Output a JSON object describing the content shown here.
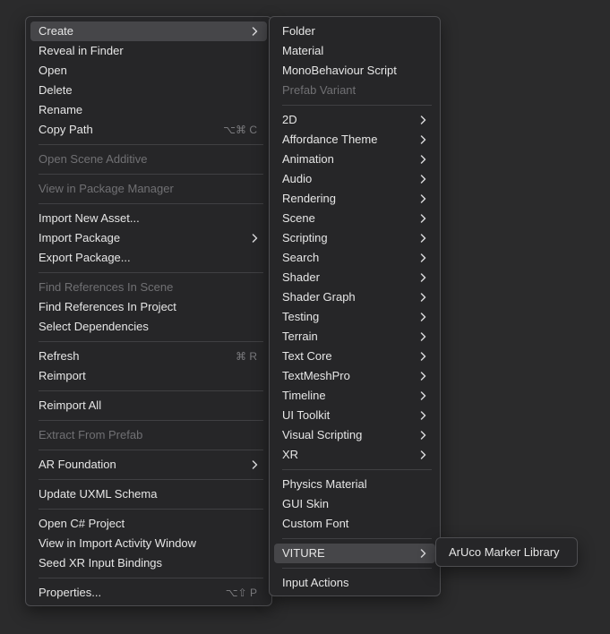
{
  "main_menu": {
    "groups": [
      [
        {
          "label": "Create",
          "submenu": true,
          "highlighted": true
        },
        {
          "label": "Reveal in Finder"
        },
        {
          "label": "Open"
        },
        {
          "label": "Delete"
        },
        {
          "label": "Rename"
        },
        {
          "label": "Copy Path",
          "shortcut": "⌥⌘ C"
        }
      ],
      [
        {
          "label": "Open Scene Additive",
          "disabled": true
        }
      ],
      [
        {
          "label": "View in Package Manager",
          "disabled": true
        }
      ],
      [
        {
          "label": "Import New Asset..."
        },
        {
          "label": "Import Package",
          "submenu": true
        },
        {
          "label": "Export Package..."
        }
      ],
      [
        {
          "label": "Find References In Scene",
          "disabled": true
        },
        {
          "label": "Find References In Project"
        },
        {
          "label": "Select Dependencies"
        }
      ],
      [
        {
          "label": "Refresh",
          "shortcut": "⌘ R"
        },
        {
          "label": "Reimport"
        }
      ],
      [
        {
          "label": "Reimport All"
        }
      ],
      [
        {
          "label": "Extract From Prefab",
          "disabled": true
        }
      ],
      [
        {
          "label": "AR Foundation",
          "submenu": true
        }
      ],
      [
        {
          "label": "Update UXML Schema"
        }
      ],
      [
        {
          "label": "Open C# Project"
        },
        {
          "label": "View in Import Activity Window"
        },
        {
          "label": "Seed XR Input Bindings"
        }
      ],
      [
        {
          "label": "Properties...",
          "shortcut": "⌥⇧ P"
        }
      ]
    ]
  },
  "create_menu": {
    "groups": [
      [
        {
          "label": "Folder"
        },
        {
          "label": "Material"
        },
        {
          "label": "MonoBehaviour Script"
        },
        {
          "label": "Prefab Variant",
          "disabled": true
        }
      ],
      [
        {
          "label": "2D",
          "submenu": true
        },
        {
          "label": "Affordance Theme",
          "submenu": true
        },
        {
          "label": "Animation",
          "submenu": true
        },
        {
          "label": "Audio",
          "submenu": true
        },
        {
          "label": "Rendering",
          "submenu": true
        },
        {
          "label": "Scene",
          "submenu": true
        },
        {
          "label": "Scripting",
          "submenu": true
        },
        {
          "label": "Search",
          "submenu": true
        },
        {
          "label": "Shader",
          "submenu": true
        },
        {
          "label": "Shader Graph",
          "submenu": true
        },
        {
          "label": "Testing",
          "submenu": true
        },
        {
          "label": "Terrain",
          "submenu": true
        },
        {
          "label": "Text Core",
          "submenu": true
        },
        {
          "label": "TextMeshPro",
          "submenu": true
        },
        {
          "label": "Timeline",
          "submenu": true
        },
        {
          "label": "UI Toolkit",
          "submenu": true
        },
        {
          "label": "Visual Scripting",
          "submenu": true
        },
        {
          "label": "XR",
          "submenu": true
        }
      ],
      [
        {
          "label": "Physics Material"
        },
        {
          "label": "GUI Skin"
        },
        {
          "label": "Custom Font"
        }
      ],
      [
        {
          "label": "VITURE",
          "submenu": true,
          "highlighted": true
        }
      ],
      [
        {
          "label": "Input Actions"
        }
      ]
    ]
  },
  "viture_menu": {
    "groups": [
      [
        {
          "label": "ArUco Marker Library"
        }
      ]
    ]
  },
  "colors": {
    "background": "#2b2b2c",
    "menu_background": "#262628",
    "highlight": "#464649",
    "text": "#e6e6e6",
    "disabled_text": "#707073"
  }
}
